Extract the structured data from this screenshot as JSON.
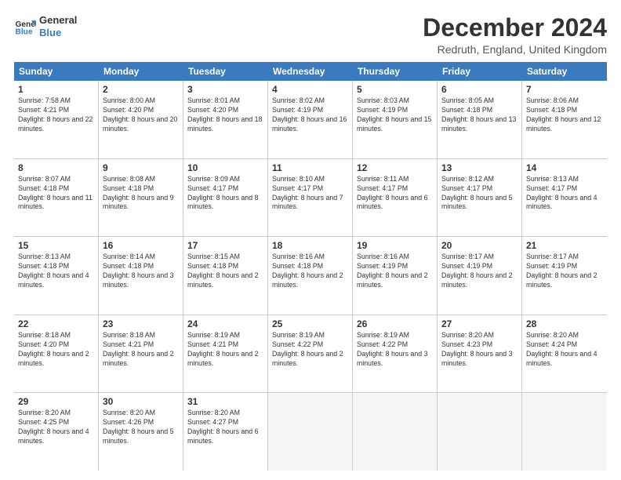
{
  "header": {
    "logo_line1": "General",
    "logo_line2": "Blue",
    "title": "December 2024",
    "subtitle": "Redruth, England, United Kingdom"
  },
  "days_of_week": [
    "Sunday",
    "Monday",
    "Tuesday",
    "Wednesday",
    "Thursday",
    "Friday",
    "Saturday"
  ],
  "weeks": [
    [
      {
        "day": "1",
        "rise": "Sunrise: 7:58 AM",
        "set": "Sunset: 4:21 PM",
        "daylight": "Daylight: 8 hours and 22 minutes."
      },
      {
        "day": "2",
        "rise": "Sunrise: 8:00 AM",
        "set": "Sunset: 4:20 PM",
        "daylight": "Daylight: 8 hours and 20 minutes."
      },
      {
        "day": "3",
        "rise": "Sunrise: 8:01 AM",
        "set": "Sunset: 4:20 PM",
        "daylight": "Daylight: 8 hours and 18 minutes."
      },
      {
        "day": "4",
        "rise": "Sunrise: 8:02 AM",
        "set": "Sunset: 4:19 PM",
        "daylight": "Daylight: 8 hours and 16 minutes."
      },
      {
        "day": "5",
        "rise": "Sunrise: 8:03 AM",
        "set": "Sunset: 4:19 PM",
        "daylight": "Daylight: 8 hours and 15 minutes."
      },
      {
        "day": "6",
        "rise": "Sunrise: 8:05 AM",
        "set": "Sunset: 4:18 PM",
        "daylight": "Daylight: 8 hours and 13 minutes."
      },
      {
        "day": "7",
        "rise": "Sunrise: 8:06 AM",
        "set": "Sunset: 4:18 PM",
        "daylight": "Daylight: 8 hours and 12 minutes."
      }
    ],
    [
      {
        "day": "8",
        "rise": "Sunrise: 8:07 AM",
        "set": "Sunset: 4:18 PM",
        "daylight": "Daylight: 8 hours and 11 minutes."
      },
      {
        "day": "9",
        "rise": "Sunrise: 8:08 AM",
        "set": "Sunset: 4:18 PM",
        "daylight": "Daylight: 8 hours and 9 minutes."
      },
      {
        "day": "10",
        "rise": "Sunrise: 8:09 AM",
        "set": "Sunset: 4:17 PM",
        "daylight": "Daylight: 8 hours and 8 minutes."
      },
      {
        "day": "11",
        "rise": "Sunrise: 8:10 AM",
        "set": "Sunset: 4:17 PM",
        "daylight": "Daylight: 8 hours and 7 minutes."
      },
      {
        "day": "12",
        "rise": "Sunrise: 8:11 AM",
        "set": "Sunset: 4:17 PM",
        "daylight": "Daylight: 8 hours and 6 minutes."
      },
      {
        "day": "13",
        "rise": "Sunrise: 8:12 AM",
        "set": "Sunset: 4:17 PM",
        "daylight": "Daylight: 8 hours and 5 minutes."
      },
      {
        "day": "14",
        "rise": "Sunrise: 8:13 AM",
        "set": "Sunset: 4:17 PM",
        "daylight": "Daylight: 8 hours and 4 minutes."
      }
    ],
    [
      {
        "day": "15",
        "rise": "Sunrise: 8:13 AM",
        "set": "Sunset: 4:18 PM",
        "daylight": "Daylight: 8 hours and 4 minutes."
      },
      {
        "day": "16",
        "rise": "Sunrise: 8:14 AM",
        "set": "Sunset: 4:18 PM",
        "daylight": "Daylight: 8 hours and 3 minutes."
      },
      {
        "day": "17",
        "rise": "Sunrise: 8:15 AM",
        "set": "Sunset: 4:18 PM",
        "daylight": "Daylight: 8 hours and 2 minutes."
      },
      {
        "day": "18",
        "rise": "Sunrise: 8:16 AM",
        "set": "Sunset: 4:18 PM",
        "daylight": "Daylight: 8 hours and 2 minutes."
      },
      {
        "day": "19",
        "rise": "Sunrise: 8:16 AM",
        "set": "Sunset: 4:19 PM",
        "daylight": "Daylight: 8 hours and 2 minutes."
      },
      {
        "day": "20",
        "rise": "Sunrise: 8:17 AM",
        "set": "Sunset: 4:19 PM",
        "daylight": "Daylight: 8 hours and 2 minutes."
      },
      {
        "day": "21",
        "rise": "Sunrise: 8:17 AM",
        "set": "Sunset: 4:19 PM",
        "daylight": "Daylight: 8 hours and 2 minutes."
      }
    ],
    [
      {
        "day": "22",
        "rise": "Sunrise: 8:18 AM",
        "set": "Sunset: 4:20 PM",
        "daylight": "Daylight: 8 hours and 2 minutes."
      },
      {
        "day": "23",
        "rise": "Sunrise: 8:18 AM",
        "set": "Sunset: 4:21 PM",
        "daylight": "Daylight: 8 hours and 2 minutes."
      },
      {
        "day": "24",
        "rise": "Sunrise: 8:19 AM",
        "set": "Sunset: 4:21 PM",
        "daylight": "Daylight: 8 hours and 2 minutes."
      },
      {
        "day": "25",
        "rise": "Sunrise: 8:19 AM",
        "set": "Sunset: 4:22 PM",
        "daylight": "Daylight: 8 hours and 2 minutes."
      },
      {
        "day": "26",
        "rise": "Sunrise: 8:19 AM",
        "set": "Sunset: 4:22 PM",
        "daylight": "Daylight: 8 hours and 3 minutes."
      },
      {
        "day": "27",
        "rise": "Sunrise: 8:20 AM",
        "set": "Sunset: 4:23 PM",
        "daylight": "Daylight: 8 hours and 3 minutes."
      },
      {
        "day": "28",
        "rise": "Sunrise: 8:20 AM",
        "set": "Sunset: 4:24 PM",
        "daylight": "Daylight: 8 hours and 4 minutes."
      }
    ],
    [
      {
        "day": "29",
        "rise": "Sunrise: 8:20 AM",
        "set": "Sunset: 4:25 PM",
        "daylight": "Daylight: 8 hours and 4 minutes."
      },
      {
        "day": "30",
        "rise": "Sunrise: 8:20 AM",
        "set": "Sunset: 4:26 PM",
        "daylight": "Daylight: 8 hours and 5 minutes."
      },
      {
        "day": "31",
        "rise": "Sunrise: 8:20 AM",
        "set": "Sunset: 4:27 PM",
        "daylight": "Daylight: 8 hours and 6 minutes."
      },
      null,
      null,
      null,
      null
    ]
  ]
}
